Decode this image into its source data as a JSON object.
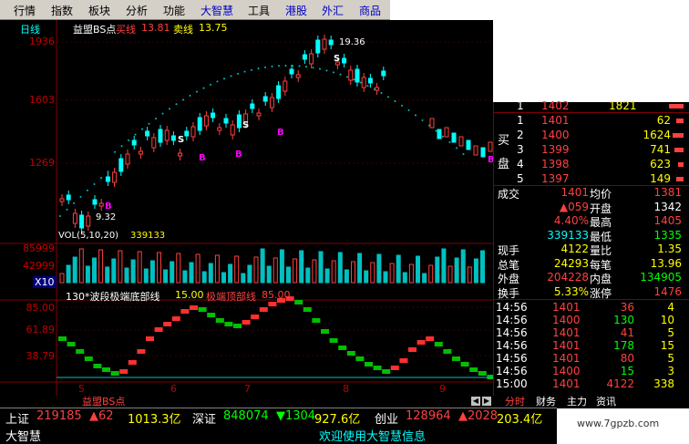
{
  "menu": [
    {
      "label": "行情",
      "accent": false
    },
    {
      "label": "指数",
      "accent": false
    },
    {
      "label": "板块",
      "accent": false
    },
    {
      "label": "分析",
      "accent": false
    },
    {
      "label": "功能",
      "accent": false
    },
    {
      "label": "大智慧",
      "accent": true
    },
    {
      "label": "工具",
      "accent": false
    },
    {
      "label": "港股",
      "accent": true
    },
    {
      "label": "外汇",
      "accent": true
    },
    {
      "label": "商品",
      "accent": true
    }
  ],
  "chart": {
    "period": "日线",
    "indicator": "益盟BS点",
    "buy_label": "买线",
    "buy_value": "13.81",
    "sell_label": "卖线",
    "sell_value": "13.75",
    "high_annot": "19.36",
    "low_annot": "9.32",
    "bs_marks": [
      "B",
      "S"
    ],
    "price_ticks": [
      "1936",
      "1603",
      "1269"
    ],
    "vol_title": "VOL(5,10,20)",
    "vol_value": "339133",
    "vol_ticks": [
      "85999",
      "42999"
    ],
    "vol_unit": "X10",
    "osc_title": "130*波段极端底部线",
    "osc_val1": "15.00",
    "osc_title2": "极端顶部线",
    "osc_val2": "85.00",
    "osc_ticks": [
      "85.00",
      "61.89",
      "38.79"
    ],
    "months": [
      "5",
      "6",
      "7",
      "8",
      "9"
    ],
    "tab_label": "益盟BS点"
  },
  "chart_data": {
    "type": "table",
    "candles_note": "",
    "price_axis": {
      "ticks": [
        1936,
        1603,
        1269
      ],
      "high": 19.36,
      "low": 9.32
    },
    "volume_axis": {
      "ticks": [
        85999,
        42999
      ]
    },
    "oscillator_axis": {
      "ticks": [
        85.0,
        61.89,
        38.79
      ]
    }
  },
  "quote": {
    "sell": [
      {
        "level": "1",
        "price": "1402",
        "vol": "1821"
      }
    ],
    "buy_side_label": [
      "买",
      "盘"
    ],
    "buy": [
      {
        "level": "1",
        "price": "1401",
        "vol": "62"
      },
      {
        "level": "2",
        "price": "1400",
        "vol": "1624"
      },
      {
        "level": "3",
        "price": "1399",
        "vol": "741"
      },
      {
        "level": "4",
        "price": "1398",
        "vol": "623"
      },
      {
        "level": "5",
        "price": "1397",
        "vol": "149"
      }
    ],
    "stats": [
      {
        "k1": "成交",
        "v1": "1401",
        "k2": "均价",
        "v2": "1381"
      },
      {
        "k1": "",
        "v1": "▲059",
        "k2": "开盘",
        "v2": "1342"
      },
      {
        "k1": "",
        "v1": "4.40%",
        "k2": "最高",
        "v2": "1405"
      },
      {
        "k1": "",
        "v1": "339133",
        "k2": "最低",
        "v2": "1335"
      },
      {
        "k1": "现手",
        "v1": "4122",
        "k2": "量比",
        "v2": "1.35"
      },
      {
        "k1": "总笔",
        "v1": "24293",
        "k2": "每笔",
        "v2": "13.96"
      },
      {
        "k1": "外盘",
        "v1": "204228",
        "k2": "内盘",
        "v2": "134905"
      },
      {
        "k1": "换手",
        "v1": "5.33%",
        "k2": "涨停",
        "v2": "1476"
      }
    ],
    "ticks": [
      {
        "t": "14:56",
        "p": "1401",
        "v": "36",
        "n": "4"
      },
      {
        "t": "14:56",
        "p": "1400",
        "v": "130",
        "n": "10"
      },
      {
        "t": "14:56",
        "p": "1401",
        "v": "41",
        "n": "5"
      },
      {
        "t": "14:56",
        "p": "1401",
        "v": "178",
        "n": "15"
      },
      {
        "t": "14:56",
        "p": "1401",
        "v": "80",
        "n": "5"
      },
      {
        "t": "14:56",
        "p": "1400",
        "v": "15",
        "n": "3"
      },
      {
        "t": "15:00",
        "p": "1401",
        "v": "4122",
        "n": "338"
      }
    ],
    "bottom_tabs": [
      "分时",
      "财务",
      "主力",
      "资讯"
    ]
  },
  "status": {
    "items": [
      {
        "k": "上证",
        "v": "219185",
        "d": "▲62",
        "m": "1013.3亿"
      },
      {
        "k": "深证",
        "v": "848074",
        "d": "▼1304",
        "m": "927.6亿"
      },
      {
        "k": "创业",
        "v": "128964",
        "d": "▲2028",
        "m": "203.4亿"
      }
    ],
    "brand": "大智慧",
    "ticker": "欢迎使用大智慧信息",
    "watermark": "www.7gpzb.com"
  }
}
